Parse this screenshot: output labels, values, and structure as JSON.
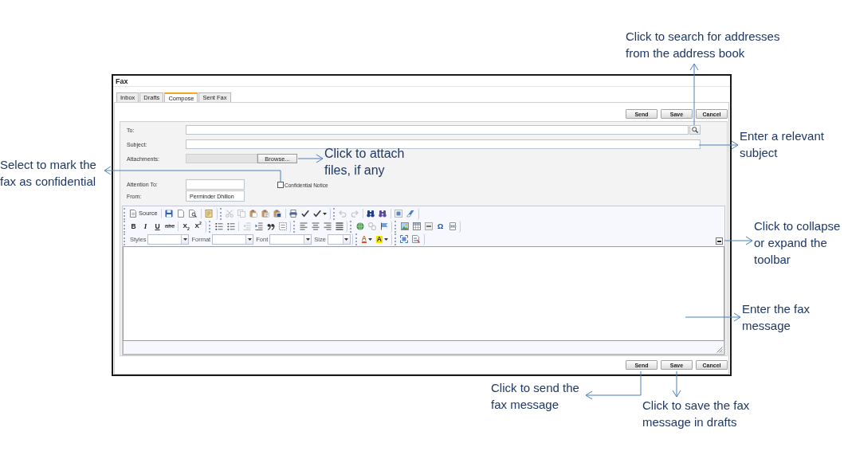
{
  "window": {
    "title": "Fax"
  },
  "tabs": [
    {
      "label": "Inbox",
      "selected": false
    },
    {
      "label": "Drafts",
      "selected": false
    },
    {
      "label": "Compose",
      "selected": true
    },
    {
      "label": "Sent Fax",
      "selected": false
    }
  ],
  "top_actions": [
    "Send",
    "Save",
    "Cancel"
  ],
  "form": {
    "to": {
      "label": "To:"
    },
    "subject": {
      "label": "Subject:"
    },
    "attachments": {
      "label": "Attachments:",
      "button": "Browse..."
    },
    "attention": {
      "label": "Attention To:"
    },
    "confidential": {
      "label": "Confidential Notice",
      "checked": false
    },
    "from": {
      "label": "From:",
      "value": "Perminder Dhillon"
    }
  },
  "editor": {
    "toolbar_expanded": true,
    "toolbar": [
      [
        [
          [
            {
              "kind": "button",
              "label": "Source",
              "disabled": false
            }
          ],
          [
            {
              "kind": "button",
              "disabled": false
            },
            {
              "kind": "button",
              "disabled": false
            },
            {
              "kind": "button",
              "disabled": false
            }
          ],
          [
            {
              "kind": "button",
              "disabled": false
            }
          ]
        ],
        [
          [
            {
              "kind": "button",
              "disabled": true
            },
            {
              "kind": "button",
              "disabled": true
            },
            {
              "kind": "button",
              "disabled": false
            },
            {
              "kind": "button",
              "disabled": false
            },
            {
              "kind": "button",
              "disabled": false
            }
          ],
          [
            {
              "kind": "button",
              "disabled": false
            },
            {
              "kind": "button",
              "disabled": false
            },
            {
              "kind": "menu",
              "disabled": false
            }
          ]
        ],
        [
          [
            {
              "kind": "button",
              "disabled": true
            },
            {
              "kind": "button",
              "disabled": true
            }
          ],
          [
            {
              "kind": "button",
              "disabled": false
            },
            {
              "kind": "button",
              "disabled": false
            }
          ],
          [
            {
              "kind": "button",
              "disabled": false
            },
            {
              "kind": "button",
              "disabled": false
            }
          ]
        ]
      ],
      [
        [
          [
            {
              "kind": "button",
              "label": "B",
              "disabled": false
            },
            {
              "kind": "button",
              "label": "I",
              "disabled": false
            },
            {
              "kind": "button",
              "label": "U",
              "disabled": false
            },
            {
              "kind": "button",
              "label": "abc",
              "disabled": false
            }
          ],
          [
            {
              "kind": "button",
              "label": "X$_{2}$",
              "disabled": false
            },
            {
              "kind": "button",
              "label": "X$^{2}$",
              "disabled": false
            }
          ]
        ],
        [
          [
            {
              "kind": "button",
              "disabled": false
            },
            {
              "kind": "button",
              "disabled": false
            }
          ],
          [
            {
              "kind": "button",
              "disabled": true
            },
            {
              "kind": "button",
              "disabled": false
            },
            {
              "kind": "button",
              "disabled": false
            },
            {
              "kind": "button",
              "disabled": false
            }
          ]
        ],
        [
          [
            {
              "kind": "button",
              "disabled": false
            },
            {
              "kind": "button",
              "disabled": false
            },
            {
              "kind": "button",
              "disabled": false
            },
            {
              "kind": "button",
              "disabled": false
            }
          ]
        ],
        [
          [
            {
              "kind": "button",
              "disabled": false
            },
            {
              "kind": "button",
              "disabled": true
            },
            {
              "kind": "button",
              "disabled": false
            }
          ]
        ],
        [
          [
            {
              "kind": "button",
              "disabled": false
            },
            {
              "kind": "button",
              "disabled": false
            },
            {
              "kind": "button",
              "disabled": false
            },
            {
              "kind": "button",
              "label": "Ω",
              "disabled": false
            },
            {
              "kind": "button",
              "disabled": false
            }
          ]
        ]
      ],
      [
        [
          [
            {
              "kind": "combo",
              "label": "Styles"
            },
            {
              "kind": "combo",
              "label": "Format"
            },
            {
              "kind": "combo",
              "label": "Font"
            },
            {
              "kind": "combo",
              "label": "Size"
            }
          ]
        ],
        [
          [
            {
              "kind": "menu",
              "label": "A",
              "disabled": false
            },
            {
              "kind": "menu",
              "label": "A",
              "disabled": false
            }
          ]
        ],
        [
          [
            {
              "kind": "button",
              "disabled": false
            },
            {
              "kind": "button",
              "disabled": false
            }
          ]
        ]
      ]
    ]
  },
  "bottom_actions": [
    "Send",
    "Save",
    "Cancel"
  ],
  "callouts": [
    {
      "lines": [
        "Click to search for addresses",
        "from the address book"
      ]
    },
    {
      "lines": [
        "Enter a relevant",
        "subject"
      ]
    },
    {
      "lines": [
        "Click to attach",
        "files, if any"
      ]
    },
    {
      "lines": [
        "Select to mark the",
        "fax as confidential"
      ]
    },
    {
      "lines": [
        "Click to collapse",
        "or expand the",
        "toolbar"
      ]
    },
    {
      "lines": [
        "Enter the fax",
        "message"
      ]
    },
    {
      "lines": [
        "Click to send the",
        "fax message"
      ]
    },
    {
      "lines": [
        "Click to save the fax",
        "message in drafts"
      ]
    }
  ]
}
